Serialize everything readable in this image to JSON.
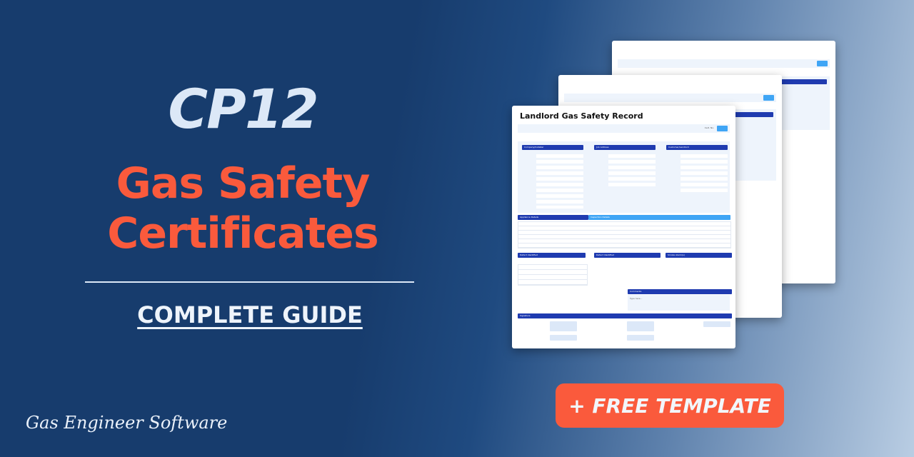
{
  "hero": {
    "code": "CP12",
    "title_line1": "Gas Safety",
    "title_line2": "Certificates",
    "subtitle": "COMPLETE GUIDE"
  },
  "brand": {
    "name": "Gas Engineer Software"
  },
  "cta": {
    "label": "+ FREE TEMPLATE"
  },
  "document": {
    "title": "Landlord Gas Safety Record",
    "cert_no_label": "Cert. No.",
    "sections": {
      "company": "Company/Installer",
      "job": "Job Address",
      "customer": "Customer/Landlord",
      "appliance": "Appliance Details",
      "inspection": "Inspection Details",
      "defects": "Defect Identified",
      "co_alarm": "Defect Identified",
      "smoke": "Smoke Alarm(s)",
      "comments": "Comments",
      "signature": "Signature"
    },
    "comments_placeholder": "Type here..."
  },
  "colors": {
    "background": "#173c6d",
    "accent": "#fa5a3c",
    "light": "#dce8f7",
    "doc_header": "#1f3bb0",
    "doc_button": "#3fa5f5"
  }
}
